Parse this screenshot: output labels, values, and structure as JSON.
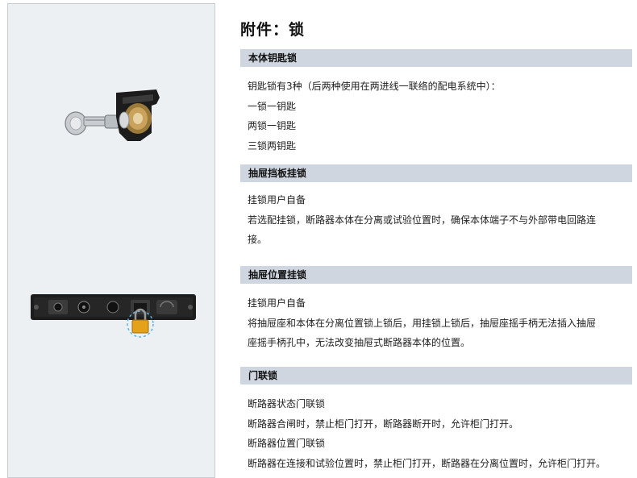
{
  "page_title": "附件：锁",
  "sections": [
    {
      "heading": "本体钥匙锁",
      "lines": [
        "钥匙锁有3种（后两种使用在两进线一联络的配电系统中）：",
        "一锁一钥匙",
        "两锁一钥匙",
        "三锁两钥匙"
      ]
    },
    {
      "heading": "抽屉挡板挂锁",
      "lines": [
        "挂锁用户自备",
        "若选配挂锁，断路器本体在分离或试验位置时，确保本体端子不与外部带电回路连",
        "接。"
      ]
    },
    {
      "heading": "抽屉位置挂锁",
      "lines": [
        "挂锁用户自备",
        "将抽屉座和本体在分离位置锁上锁后，用挂锁上锁后，抽屉座摇手柄无法插入抽屉",
        "座摇手柄孔中，无法改变抽屉式断路器本体的位置。"
      ]
    },
    {
      "heading": "门联锁",
      "lines": [
        "断路器状态门联锁",
        "断路器合闸时，禁止柜门打开，断路器断开时，允许柜门打开。",
        "断路器位置门联锁",
        "断路器在连接和试验位置时，禁止柜门打开，断路器在分离位置时，允许柜门打开。"
      ]
    }
  ],
  "colors": {
    "section_header_bg": "#cfd6e0",
    "panel_bg": "#edf0f2",
    "padlock": "#e3a21a"
  }
}
